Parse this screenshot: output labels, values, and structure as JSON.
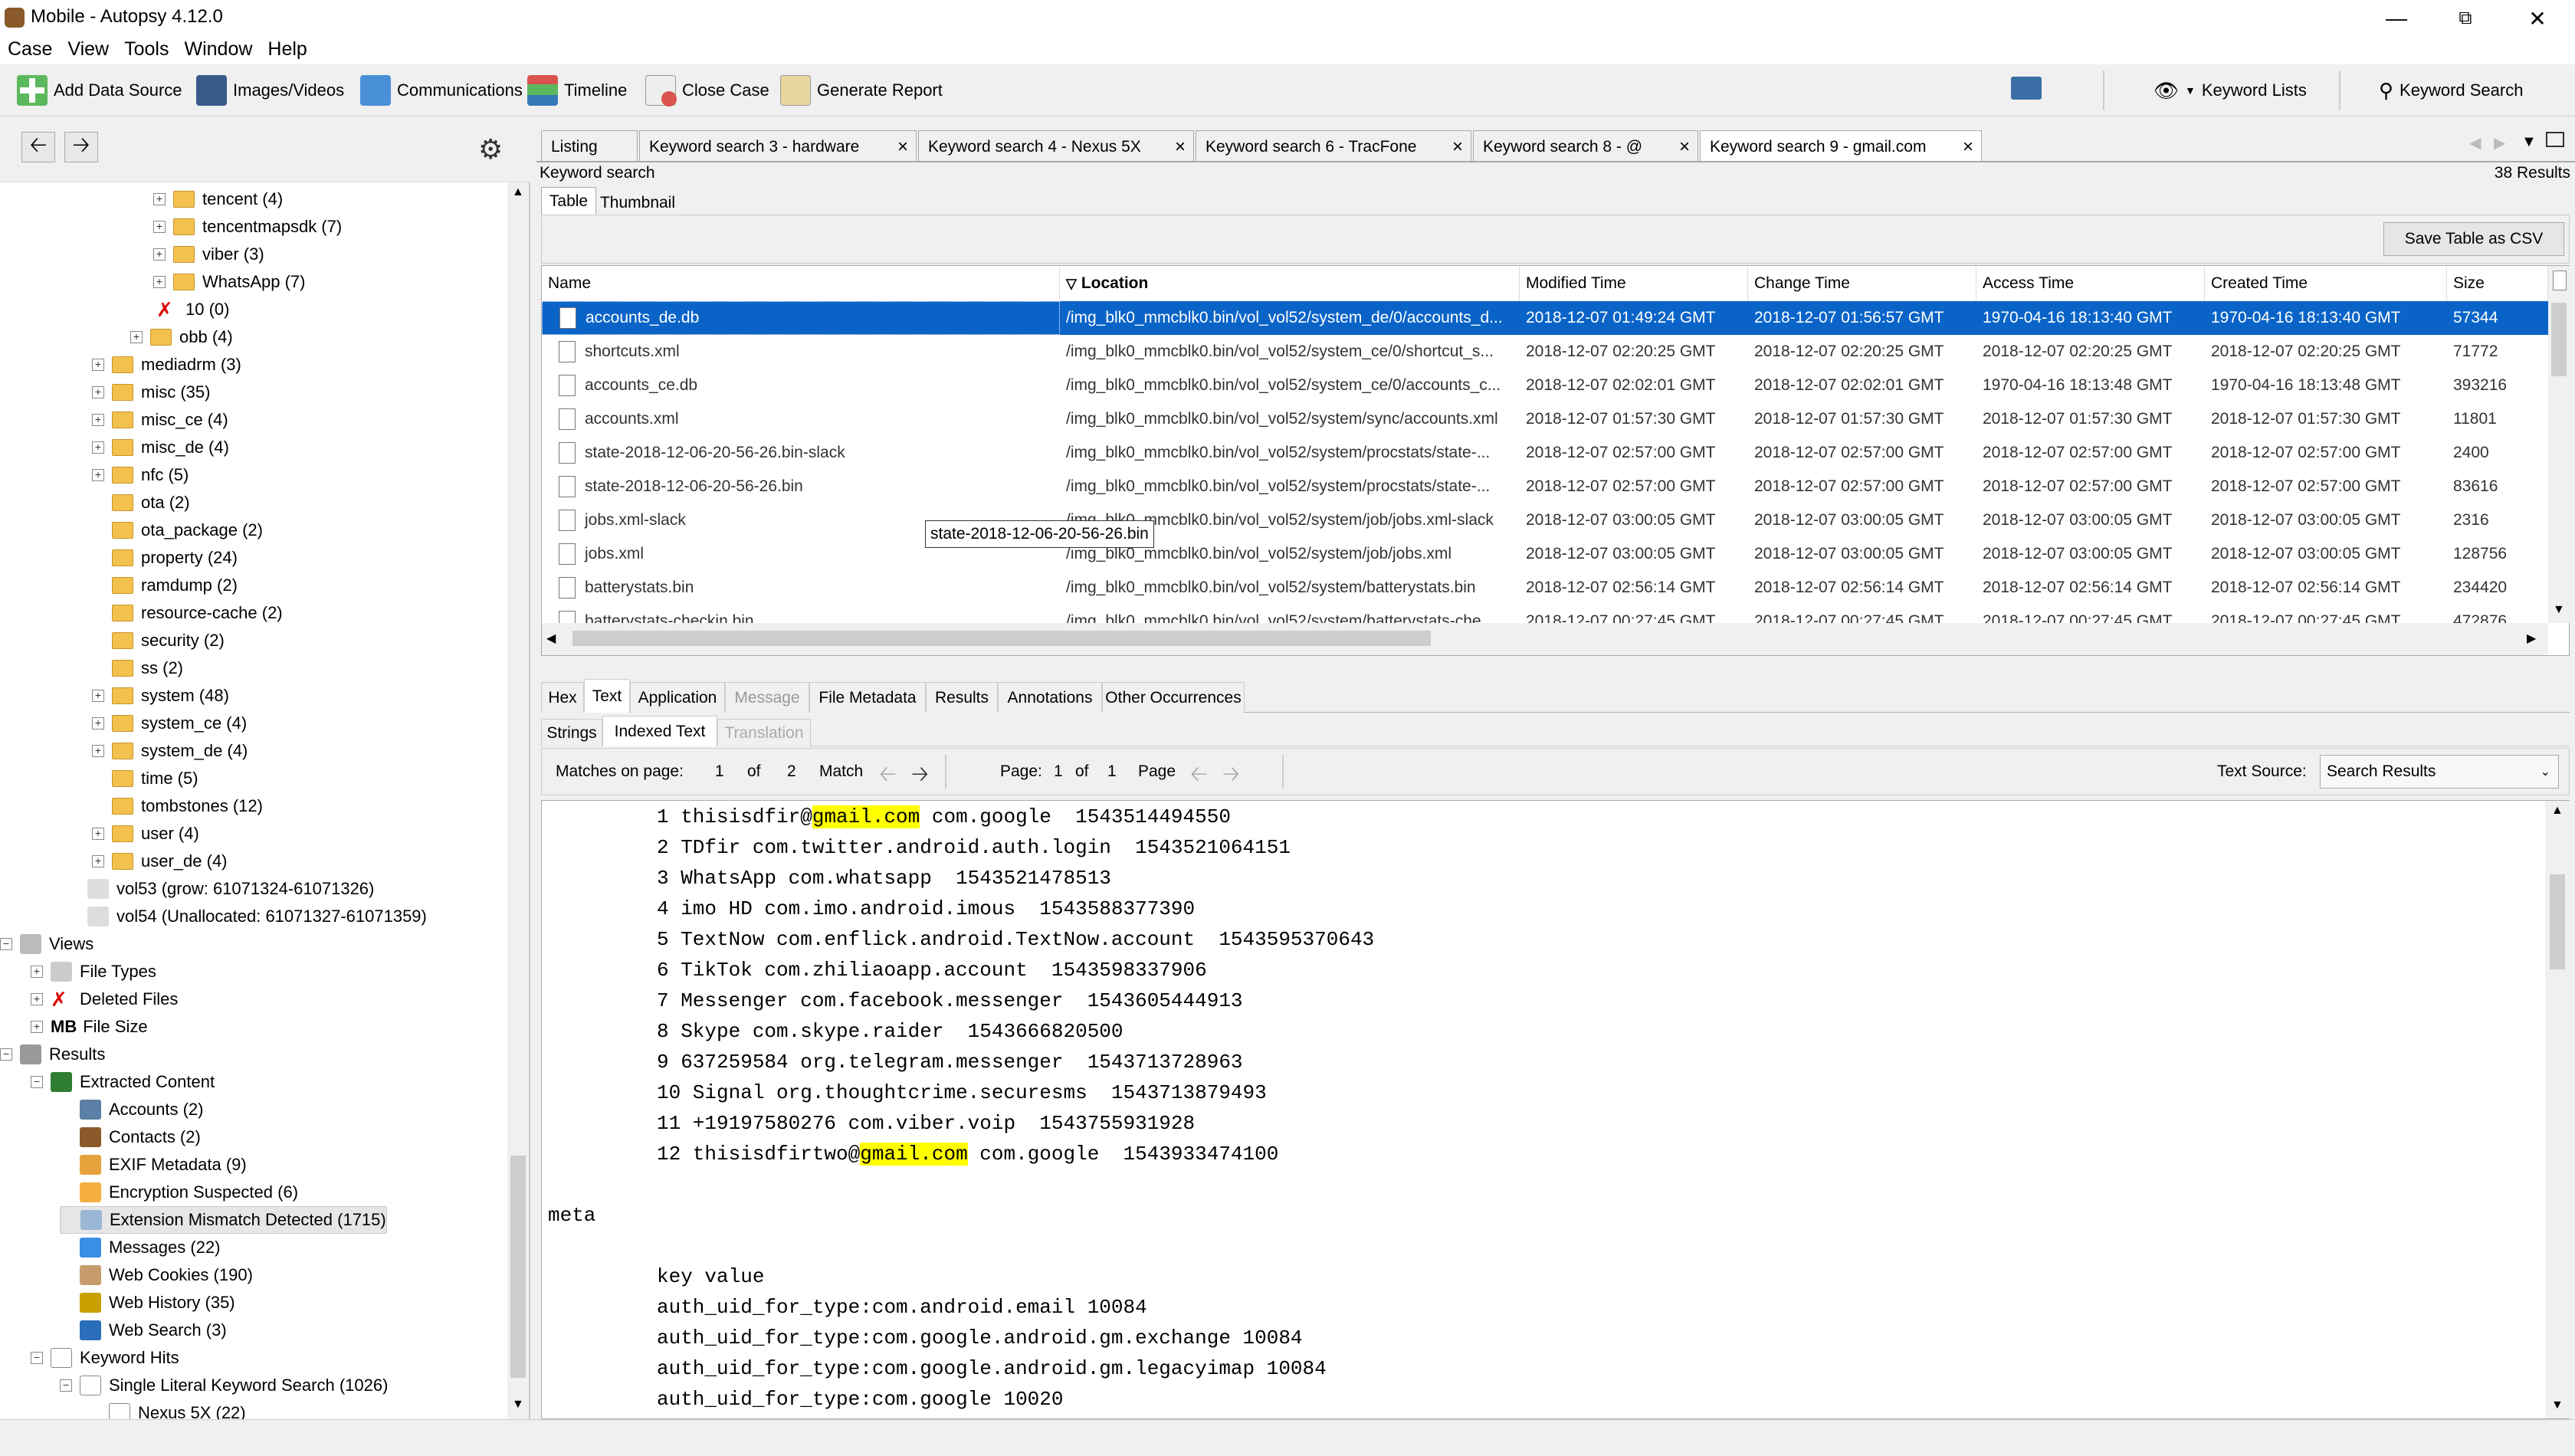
{
  "window": {
    "title": "Mobile - Autopsy 4.12.0"
  },
  "menu": [
    "Case",
    "View",
    "Tools",
    "Window",
    "Help"
  ],
  "toolbar": {
    "add_data_source": "Add Data Source",
    "images_videos": "Images/Videos",
    "communications": "Communications",
    "timeline": "Timeline",
    "close_case": "Close Case",
    "generate_report": "Generate Report",
    "keyword_lists": "Keyword Lists",
    "keyword_search": "Keyword Search"
  },
  "tree": [
    {
      "label": "tencent (4)",
      "indent": 1,
      "exp": "+",
      "icon": "folder"
    },
    {
      "label": "tencentmapsdk (7)",
      "indent": 1,
      "exp": "+",
      "icon": "folder"
    },
    {
      "label": "viber (3)",
      "indent": 1,
      "exp": "+",
      "icon": "folder"
    },
    {
      "label": "WhatsApp (7)",
      "indent": 1,
      "exp": "+",
      "icon": "folder"
    },
    {
      "label": "10 (0)",
      "indent": 2,
      "exp": "",
      "icon": "deleted"
    },
    {
      "label": "obb (4)",
      "indent": 2,
      "exp": "+",
      "icon": "folder"
    },
    {
      "label": "mediadrm (3)",
      "indent": 3,
      "exp": "+",
      "icon": "folder"
    },
    {
      "label": "misc (35)",
      "indent": 3,
      "exp": "+",
      "icon": "folder"
    },
    {
      "label": "misc_ce (4)",
      "indent": 3,
      "exp": "+",
      "icon": "folder"
    },
    {
      "label": "misc_de (4)",
      "indent": 3,
      "exp": "+",
      "icon": "folder"
    },
    {
      "label": "nfc (5)",
      "indent": 3,
      "exp": "+",
      "icon": "folder"
    },
    {
      "label": "ota (2)",
      "indent": 3,
      "exp": "",
      "icon": "folder"
    },
    {
      "label": "ota_package (2)",
      "indent": 3,
      "exp": "",
      "icon": "folder"
    },
    {
      "label": "property (24)",
      "indent": 3,
      "exp": "",
      "icon": "folder"
    },
    {
      "label": "ramdump (2)",
      "indent": 3,
      "exp": "",
      "icon": "folder"
    },
    {
      "label": "resource-cache (2)",
      "indent": 3,
      "exp": "",
      "icon": "folder"
    },
    {
      "label": "security (2)",
      "indent": 3,
      "exp": "",
      "icon": "folder"
    },
    {
      "label": "ss (2)",
      "indent": 3,
      "exp": "",
      "icon": "folder"
    },
    {
      "label": "system (48)",
      "indent": 3,
      "exp": "+",
      "icon": "folder"
    },
    {
      "label": "system_ce (4)",
      "indent": 3,
      "exp": "+",
      "icon": "folder"
    },
    {
      "label": "system_de (4)",
      "indent": 3,
      "exp": "+",
      "icon": "folder"
    },
    {
      "label": "time (5)",
      "indent": 3,
      "exp": "",
      "icon": "folder"
    },
    {
      "label": "tombstones (12)",
      "indent": 3,
      "exp": "",
      "icon": "folder"
    },
    {
      "label": "user (4)",
      "indent": 3,
      "exp": "+",
      "icon": "folder"
    },
    {
      "label": "user_de (4)",
      "indent": 3,
      "exp": "+",
      "icon": "folder"
    },
    {
      "label": "vol53 (grow: 61071324-61071326)",
      "indent": 4,
      "exp": "",
      "icon": "disk"
    },
    {
      "label": "vol54 (Unallocated: 61071327-61071359)",
      "indent": 4,
      "exp": "",
      "icon": "disk"
    },
    {
      "label": "Views",
      "indent": 5,
      "exp": "-",
      "icon": "eye"
    },
    {
      "label": "File Types",
      "indent": 6,
      "exp": "+",
      "icon": "filetypes"
    },
    {
      "label": "Deleted Files",
      "indent": 6,
      "exp": "+",
      "icon": "deleted"
    },
    {
      "label": "File Size",
      "indent": 6,
      "exp": "+",
      "icon": "mb"
    },
    {
      "label": "Results",
      "indent": 5,
      "exp": "-",
      "icon": "results"
    },
    {
      "label": "Extracted Content",
      "indent": 6,
      "exp": "-",
      "icon": "extracted"
    },
    {
      "label": "Accounts (2)",
      "indent": 7,
      "exp": "",
      "icon": "accounts"
    },
    {
      "label": "Contacts (2)",
      "indent": 7,
      "exp": "",
      "icon": "contacts"
    },
    {
      "label": "EXIF Metadata (9)",
      "indent": 7,
      "exp": "",
      "icon": "exif"
    },
    {
      "label": "Encryption Suspected (6)",
      "indent": 7,
      "exp": "",
      "icon": "encryption"
    },
    {
      "label": "Extension Mismatch Detected (1715)",
      "indent": 7,
      "exp": "",
      "icon": "mismatch",
      "selected": true
    },
    {
      "label": "Messages (22)",
      "indent": 7,
      "exp": "",
      "icon": "messages"
    },
    {
      "label": "Web Cookies (190)",
      "indent": 7,
      "exp": "",
      "icon": "cookies"
    },
    {
      "label": "Web History (35)",
      "indent": 7,
      "exp": "",
      "icon": "history"
    },
    {
      "label": "Web Search (3)",
      "indent": 7,
      "exp": "",
      "icon": "websearch"
    },
    {
      "label": "Keyword Hits",
      "indent": 6,
      "exp": "-",
      "icon": "keyword"
    },
    {
      "label": "Single Literal Keyword Search (1026)",
      "indent": 7,
      "exp": "-",
      "icon": "keyword"
    },
    {
      "label": "Nexus 5X (22)",
      "indent": 8,
      "exp": "",
      "icon": "keyword"
    }
  ],
  "tabs": [
    {
      "label": "Listing",
      "closable": false
    },
    {
      "label": "Keyword search 3 - hardware",
      "closable": true
    },
    {
      "label": "Keyword search 4 - Nexus 5X",
      "closable": true
    },
    {
      "label": "Keyword search 6 - TracFone",
      "closable": true
    },
    {
      "label": "Keyword search 8 - @",
      "closable": true
    },
    {
      "label": "Keyword search 9 - gmail.com",
      "closable": true,
      "active": true
    }
  ],
  "result_header": {
    "title": "Keyword search",
    "count": "38  Results"
  },
  "view_tabs": [
    "Table",
    "Thumbnail"
  ],
  "save_csv": "Save Table as CSV",
  "columns": [
    "Name",
    "Location",
    "Modified Time",
    "Change Time",
    "Access Time",
    "Created Time",
    "Size"
  ],
  "rows": [
    [
      "accounts_de.db",
      "/img_blk0_mmcblk0.bin/vol_vol52/system_de/0/accounts_d...",
      "2018-12-07 01:49:24 GMT",
      "2018-12-07 01:56:57 GMT",
      "1970-04-16 18:13:40 GMT",
      "1970-04-16 18:13:40 GMT",
      "57344"
    ],
    [
      "shortcuts.xml",
      "/img_blk0_mmcblk0.bin/vol_vol52/system_ce/0/shortcut_s...",
      "2018-12-07 02:20:25 GMT",
      "2018-12-07 02:20:25 GMT",
      "2018-12-07 02:20:25 GMT",
      "2018-12-07 02:20:25 GMT",
      "71772"
    ],
    [
      "accounts_ce.db",
      "/img_blk0_mmcblk0.bin/vol_vol52/system_ce/0/accounts_c...",
      "2018-12-07 02:02:01 GMT",
      "2018-12-07 02:02:01 GMT",
      "1970-04-16 18:13:48 GMT",
      "1970-04-16 18:13:48 GMT",
      "393216"
    ],
    [
      "accounts.xml",
      "/img_blk0_mmcblk0.bin/vol_vol52/system/sync/accounts.xml",
      "2018-12-07 01:57:30 GMT",
      "2018-12-07 01:57:30 GMT",
      "2018-12-07 01:57:30 GMT",
      "2018-12-07 01:57:30 GMT",
      "11801"
    ],
    [
      "state-2018-12-06-20-56-26.bin-slack",
      "/img_blk0_mmcblk0.bin/vol_vol52/system/procstats/state-...",
      "2018-12-07 02:57:00 GMT",
      "2018-12-07 02:57:00 GMT",
      "2018-12-07 02:57:00 GMT",
      "2018-12-07 02:57:00 GMT",
      "2400"
    ],
    [
      "state-2018-12-06-20-56-26.bin",
      "/img_blk0_mmcblk0.bin/vol_vol52/system/procstats/state-...",
      "2018-12-07 02:57:00 GMT",
      "2018-12-07 02:57:00 GMT",
      "2018-12-07 02:57:00 GMT",
      "2018-12-07 02:57:00 GMT",
      "83616"
    ],
    [
      "jobs.xml-slack",
      "/img_blk0_mmcblk0.bin/vol_vol52/system/job/jobs.xml-slack",
      "2018-12-07 03:00:05 GMT",
      "2018-12-07 03:00:05 GMT",
      "2018-12-07 03:00:05 GMT",
      "2018-12-07 03:00:05 GMT",
      "2316"
    ],
    [
      "jobs.xml",
      "/img_blk0_mmcblk0.bin/vol_vol52/system/job/jobs.xml",
      "2018-12-07 03:00:05 GMT",
      "2018-12-07 03:00:05 GMT",
      "2018-12-07 03:00:05 GMT",
      "2018-12-07 03:00:05 GMT",
      "128756"
    ],
    [
      "batterystats.bin",
      "/img_blk0_mmcblk0.bin/vol_vol52/system/batterystats.bin",
      "2018-12-07 02:56:14 GMT",
      "2018-12-07 02:56:14 GMT",
      "2018-12-07 02:56:14 GMT",
      "2018-12-07 02:56:14 GMT",
      "234420"
    ],
    [
      "batterystats-checkin.bin",
      "/img_blk0_mmcblk0.bin/vol_vol52/system/batterystats-che...",
      "2018-12-07 00:27:45 GMT",
      "2018-12-07 00:27:45 GMT",
      "2018-12-07 00:27:45 GMT",
      "2018-12-07 00:27:45 GMT",
      "472876"
    ]
  ],
  "tooltip": "state-2018-12-06-20-56-26.bin",
  "content_tabs": [
    {
      "label": "Hex"
    },
    {
      "label": "Text",
      "active": true
    },
    {
      "label": "Application"
    },
    {
      "label": "Message",
      "disabled": true
    },
    {
      "label": "File Metadata"
    },
    {
      "label": "Results"
    },
    {
      "label": "Annotations"
    },
    {
      "label": "Other Occurrences"
    }
  ],
  "text_tabs": [
    {
      "label": "Strings"
    },
    {
      "label": "Indexed Text",
      "active": true
    },
    {
      "label": "Translation",
      "disabled": true
    }
  ],
  "matchbar": {
    "matches_label": "Matches on page:",
    "match_cur": "1",
    "of1": "of",
    "match_total": "2",
    "match_label": "Match",
    "page_label": "Page:",
    "page_cur": "1",
    "of2": "of",
    "page_total": "1",
    "page_word": "Page",
    "text_source_label": "Text Source:",
    "text_source_value": "Search Results"
  },
  "text_lines": [
    {
      "pre": "1 thisisdfir@",
      "hl": "gmail.com",
      "post": " com.google  1543514494550"
    },
    {
      "pre": "2 TDfir com.twitter.android.auth.login  1543521064151"
    },
    {
      "pre": "3 WhatsApp com.whatsapp  1543521478513"
    },
    {
      "pre": "4 imo HD com.imo.android.imous  1543588377390"
    },
    {
      "pre": "5 TextNow com.enflick.android.TextNow.account  1543595370643"
    },
    {
      "pre": "6 TikTok com.zhiliaoapp.account  1543598337906"
    },
    {
      "pre": "7 Messenger com.facebook.messenger  1543605444913"
    },
    {
      "pre": "8 Skype com.skype.raider  1543666820500"
    },
    {
      "pre": "9 637259584 org.telegram.messenger  1543713728963"
    },
    {
      "pre": "10 Signal org.thoughtcrime.securesms  1543713879493"
    },
    {
      "pre": "11 +19197580276 com.viber.voip  1543755931928"
    },
    {
      "pre": "12 thisisdfirtwo@",
      "hl": "gmail.com",
      "post": " com.google  1543933474100"
    },
    {
      "pre": "",
      "blank": true
    },
    {
      "pre": "meta",
      "outdent": true
    },
    {
      "pre": "",
      "blank": true
    },
    {
      "pre": "key value"
    },
    {
      "pre": "auth_uid_for_type:com.android.email 10084"
    },
    {
      "pre": "auth_uid_for_type:com.google.android.gm.exchange 10084"
    },
    {
      "pre": "auth_uid_for_type:com.google.android.gm.legacyimap 10084"
    },
    {
      "pre": "auth_uid_for_type:com.google 10020"
    }
  ]
}
